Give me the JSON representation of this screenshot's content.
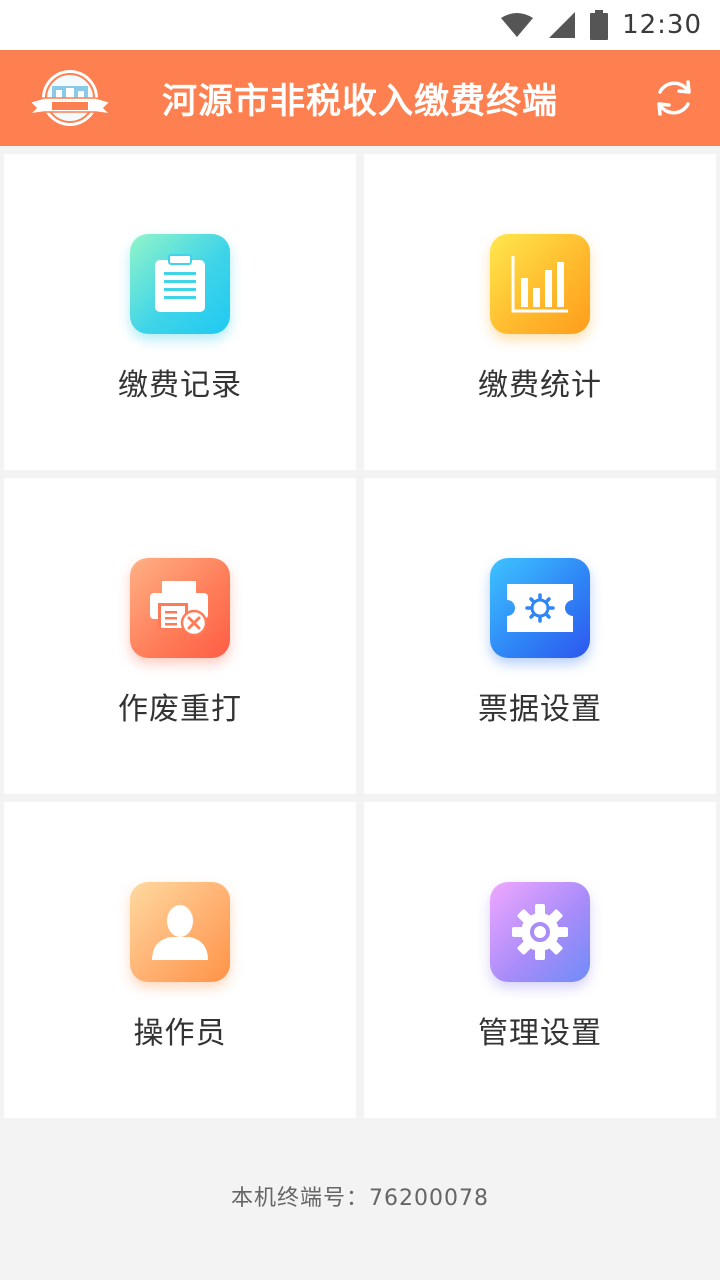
{
  "status_bar": {
    "time": "12:30",
    "icons": [
      "wifi-icon",
      "signal-icon",
      "battery-icon"
    ]
  },
  "app_bar": {
    "title": "河源市非税收入缴费终端",
    "logo_icon": "city-logo-icon",
    "refresh_icon": "refresh-icon",
    "color": "#fe7f4f"
  },
  "menu": {
    "items": [
      {
        "label": "缴费记录",
        "icon": "clipboard-icon"
      },
      {
        "label": "缴费统计",
        "icon": "bar-chart-icon"
      },
      {
        "label": "作废重打",
        "icon": "printer-cancel-icon"
      },
      {
        "label": "票据设置",
        "icon": "ticket-gear-icon"
      },
      {
        "label": "操作员",
        "icon": "user-icon"
      },
      {
        "label": "管理设置",
        "icon": "gear-icon"
      }
    ]
  },
  "footer": {
    "terminal_text": "本机终端号：76200078"
  }
}
